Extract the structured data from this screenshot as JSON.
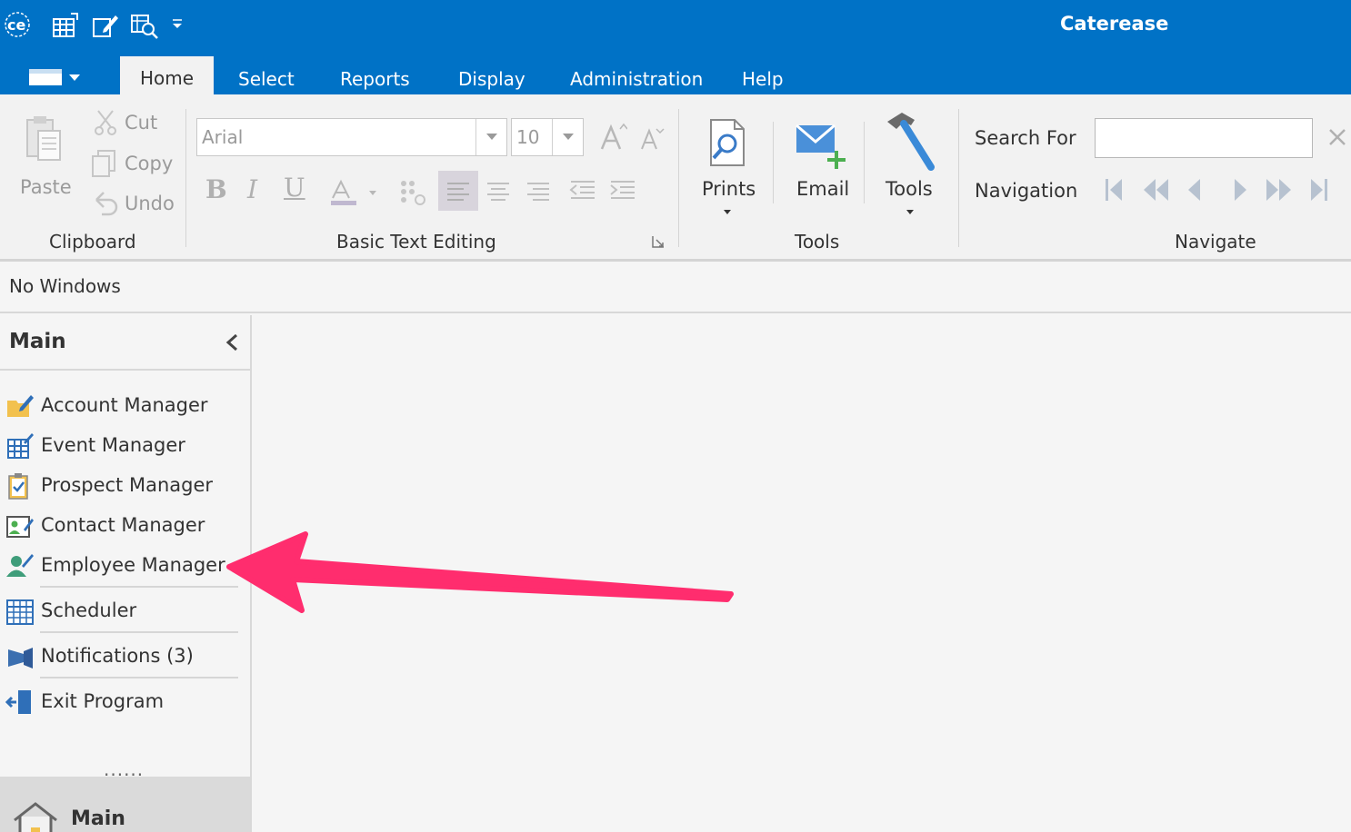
{
  "window": {
    "title": "Caterease",
    "logo_icon": "caterease-logo-icon",
    "quick_access": [
      "calendar-grid-icon",
      "edit-account-icon",
      "find-icon",
      "qat-dropdown-icon"
    ]
  },
  "tabs": [
    {
      "label": "Home",
      "active": true
    },
    {
      "label": "Select",
      "active": false
    },
    {
      "label": "Reports",
      "active": false
    },
    {
      "label": "Display",
      "active": false
    },
    {
      "label": "Administration",
      "active": false
    },
    {
      "label": "Help",
      "active": false
    }
  ],
  "ribbon": {
    "clipboard": {
      "label": "Clipboard",
      "paste": "Paste",
      "cut": "Cut",
      "copy": "Copy",
      "undo": "Undo"
    },
    "text_editing": {
      "label": "Basic Text Editing",
      "font": "Arial",
      "size": "10"
    },
    "tools": {
      "label": "Tools",
      "prints": "Prints",
      "email": "Email",
      "tools": "Tools"
    },
    "navigate": {
      "label": "Navigate",
      "search_for": "Search For",
      "search_value": "",
      "navigation": "Navigation"
    }
  },
  "windows_bar": {
    "text": "No Windows"
  },
  "sidebar": {
    "title": "Main",
    "items": [
      {
        "label": "Account Manager",
        "icon": "account-manager-icon"
      },
      {
        "label": "Event Manager",
        "icon": "event-manager-icon"
      },
      {
        "label": "Prospect Manager",
        "icon": "prospect-manager-icon"
      },
      {
        "label": "Contact Manager",
        "icon": "contact-manager-icon"
      },
      {
        "label": "Employee Manager",
        "icon": "employee-manager-icon"
      },
      {
        "label": "Scheduler",
        "icon": "scheduler-icon"
      },
      {
        "label": "Notifications (3)",
        "icon": "notifications-icon"
      },
      {
        "label": "Exit Program",
        "icon": "exit-program-icon"
      }
    ],
    "more": "......",
    "bottom_button": "Main"
  },
  "colors": {
    "brand": "#0072c6",
    "ribbon_bg": "#f2f2f2",
    "annotation_arrow": "#ff2d6e"
  }
}
